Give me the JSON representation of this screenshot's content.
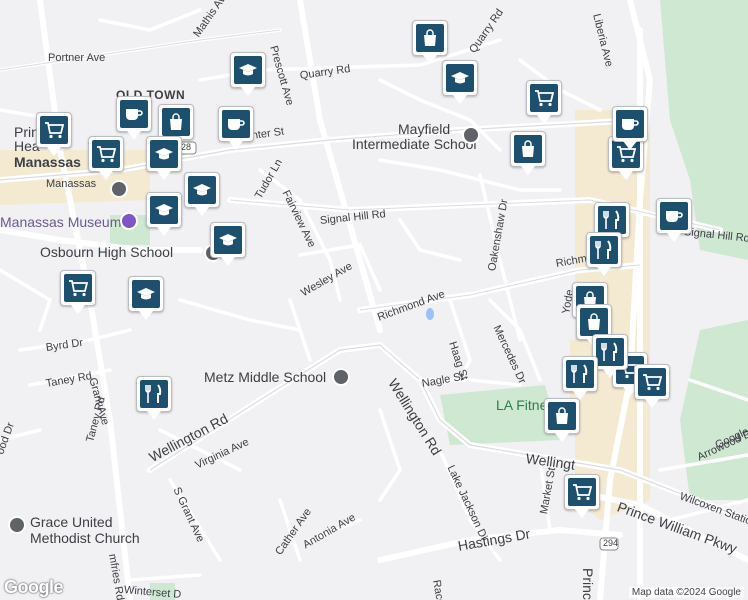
{
  "map": {
    "attribution": "Map data ©2024 Google",
    "logo": "Google"
  },
  "roads": {
    "portner_ave": "Portner Ave",
    "prescott_ave": "Prescott Ave",
    "quarry_rd_1": "Quarry Rd",
    "quarry_rd_2": "Quarry Rd",
    "liberia_ave": "Liberia Ave",
    "center_st": "Center St",
    "tudor_ln": "Tudor Ln",
    "fairview_ave": "Fairview Ave",
    "signal_hill_rd_1": "Signal Hill Rd",
    "signal_hill_rd_2": "Signal Hill Rd",
    "oakenshaw_dr": "Oakenshaw Dr",
    "wesley_ave": "Wesley Ave",
    "richmond_ave": "Richmond Ave",
    "richmond_2": "Richmo",
    "haag_st": "Haag St",
    "mercedes_dr": "Mercedes Dr",
    "byrd_dr": "Byrd Dr",
    "taney_rd_1": "Taney Rd",
    "taney_rd_2": "Taney Rd",
    "grant_ave": "Grant Ave",
    "nagle_st": "Nagle St",
    "wellington_rd_1": "Wellington Rd",
    "wellington_rd_2": "Wellington Rd",
    "wellington_rd_3": "Wellingt",
    "virginia_ave": "Virginia Ave",
    "s_grant_ave": "S Grant Ave",
    "wood_dr": "ood Dr",
    "lake_jackson_dr": "Lake Jackson Dr",
    "arrowood_dr": "Arrowood Dr",
    "market_st": "Market St",
    "yoder": "Yode",
    "prince_william_pkwy": "Prince William Pkwy",
    "wilcoxen_station": "Wilcoxen Station",
    "google": "Google",
    "cather_ave": "Cather Ave",
    "antonia_ave": "Antonia Ave",
    "hastings_dr": "Hastings Dr",
    "racq": "Racqu",
    "winterset": "Winterset D",
    "mfries_rd": "mfries Rd",
    "prince_w": "Prince W",
    "mathis_ave": "Mathis Ave",
    "route_294": "294",
    "route_28": "28"
  },
  "places": {
    "old_town": "OLD TOWN",
    "manassas": "Manassas",
    "manassas_2": "Manassas",
    "manassas_museum": "Manassas Museum",
    "osbourn_high_school": "Osbourn High School",
    "mayfield": "Mayfield",
    "mayfield_2": "Intermediate School",
    "metz_middle_school": "Metz Middle School",
    "la_fitness": "LA Fitne",
    "grace_united": "Grace United",
    "grace_united_2": "Methodist Church",
    "prince_william_health": "Prin",
    "prince_william_health_2": "Hea"
  },
  "markers": [
    {
      "type": "shopping",
      "icon": "shopping-bag-icon"
    },
    {
      "type": "school",
      "icon": "graduation-cap-icon"
    },
    {
      "type": "grocery",
      "icon": "shopping-cart-icon"
    },
    {
      "type": "coffee",
      "icon": "coffee-cup-icon"
    },
    {
      "type": "restaurant",
      "icon": "fork-knife-icon"
    }
  ]
}
